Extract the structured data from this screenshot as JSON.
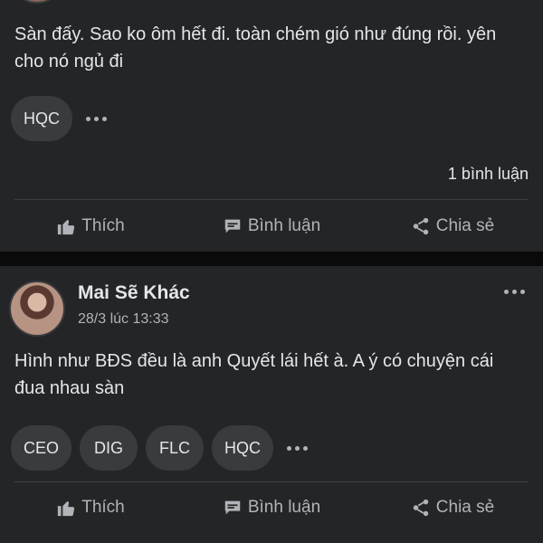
{
  "post1": {
    "text": "Sàn đấy. Sao ko ôm hết đi. toàn chém gió như đúng rồi. yên cho nó ngủ đi",
    "tags": [
      "HQC"
    ],
    "comment_count": "1 bình luận",
    "actions": {
      "like": "Thích",
      "comment": "Bình luận",
      "share": "Chia sẻ"
    }
  },
  "post2": {
    "author": "Mai Sẽ Khác",
    "timestamp": "28/3 lúc 13:33",
    "text": "Hình như BĐS đều là anh Quyết lái hết à. A ý có chuyện cái đua nhau sàn",
    "tags": [
      "CEO",
      "DIG",
      "FLC",
      "HQC"
    ],
    "actions": {
      "like": "Thích",
      "comment": "Bình luận",
      "share": "Chia sẻ"
    }
  },
  "colors": {
    "card": "#242526",
    "background": "#0a0a0a",
    "chip": "#3a3b3c",
    "text": "#e4e6eb",
    "muted": "#b0b3b8"
  },
  "icons": [
    "like-icon",
    "comment-icon",
    "share-icon",
    "more-icon"
  ]
}
